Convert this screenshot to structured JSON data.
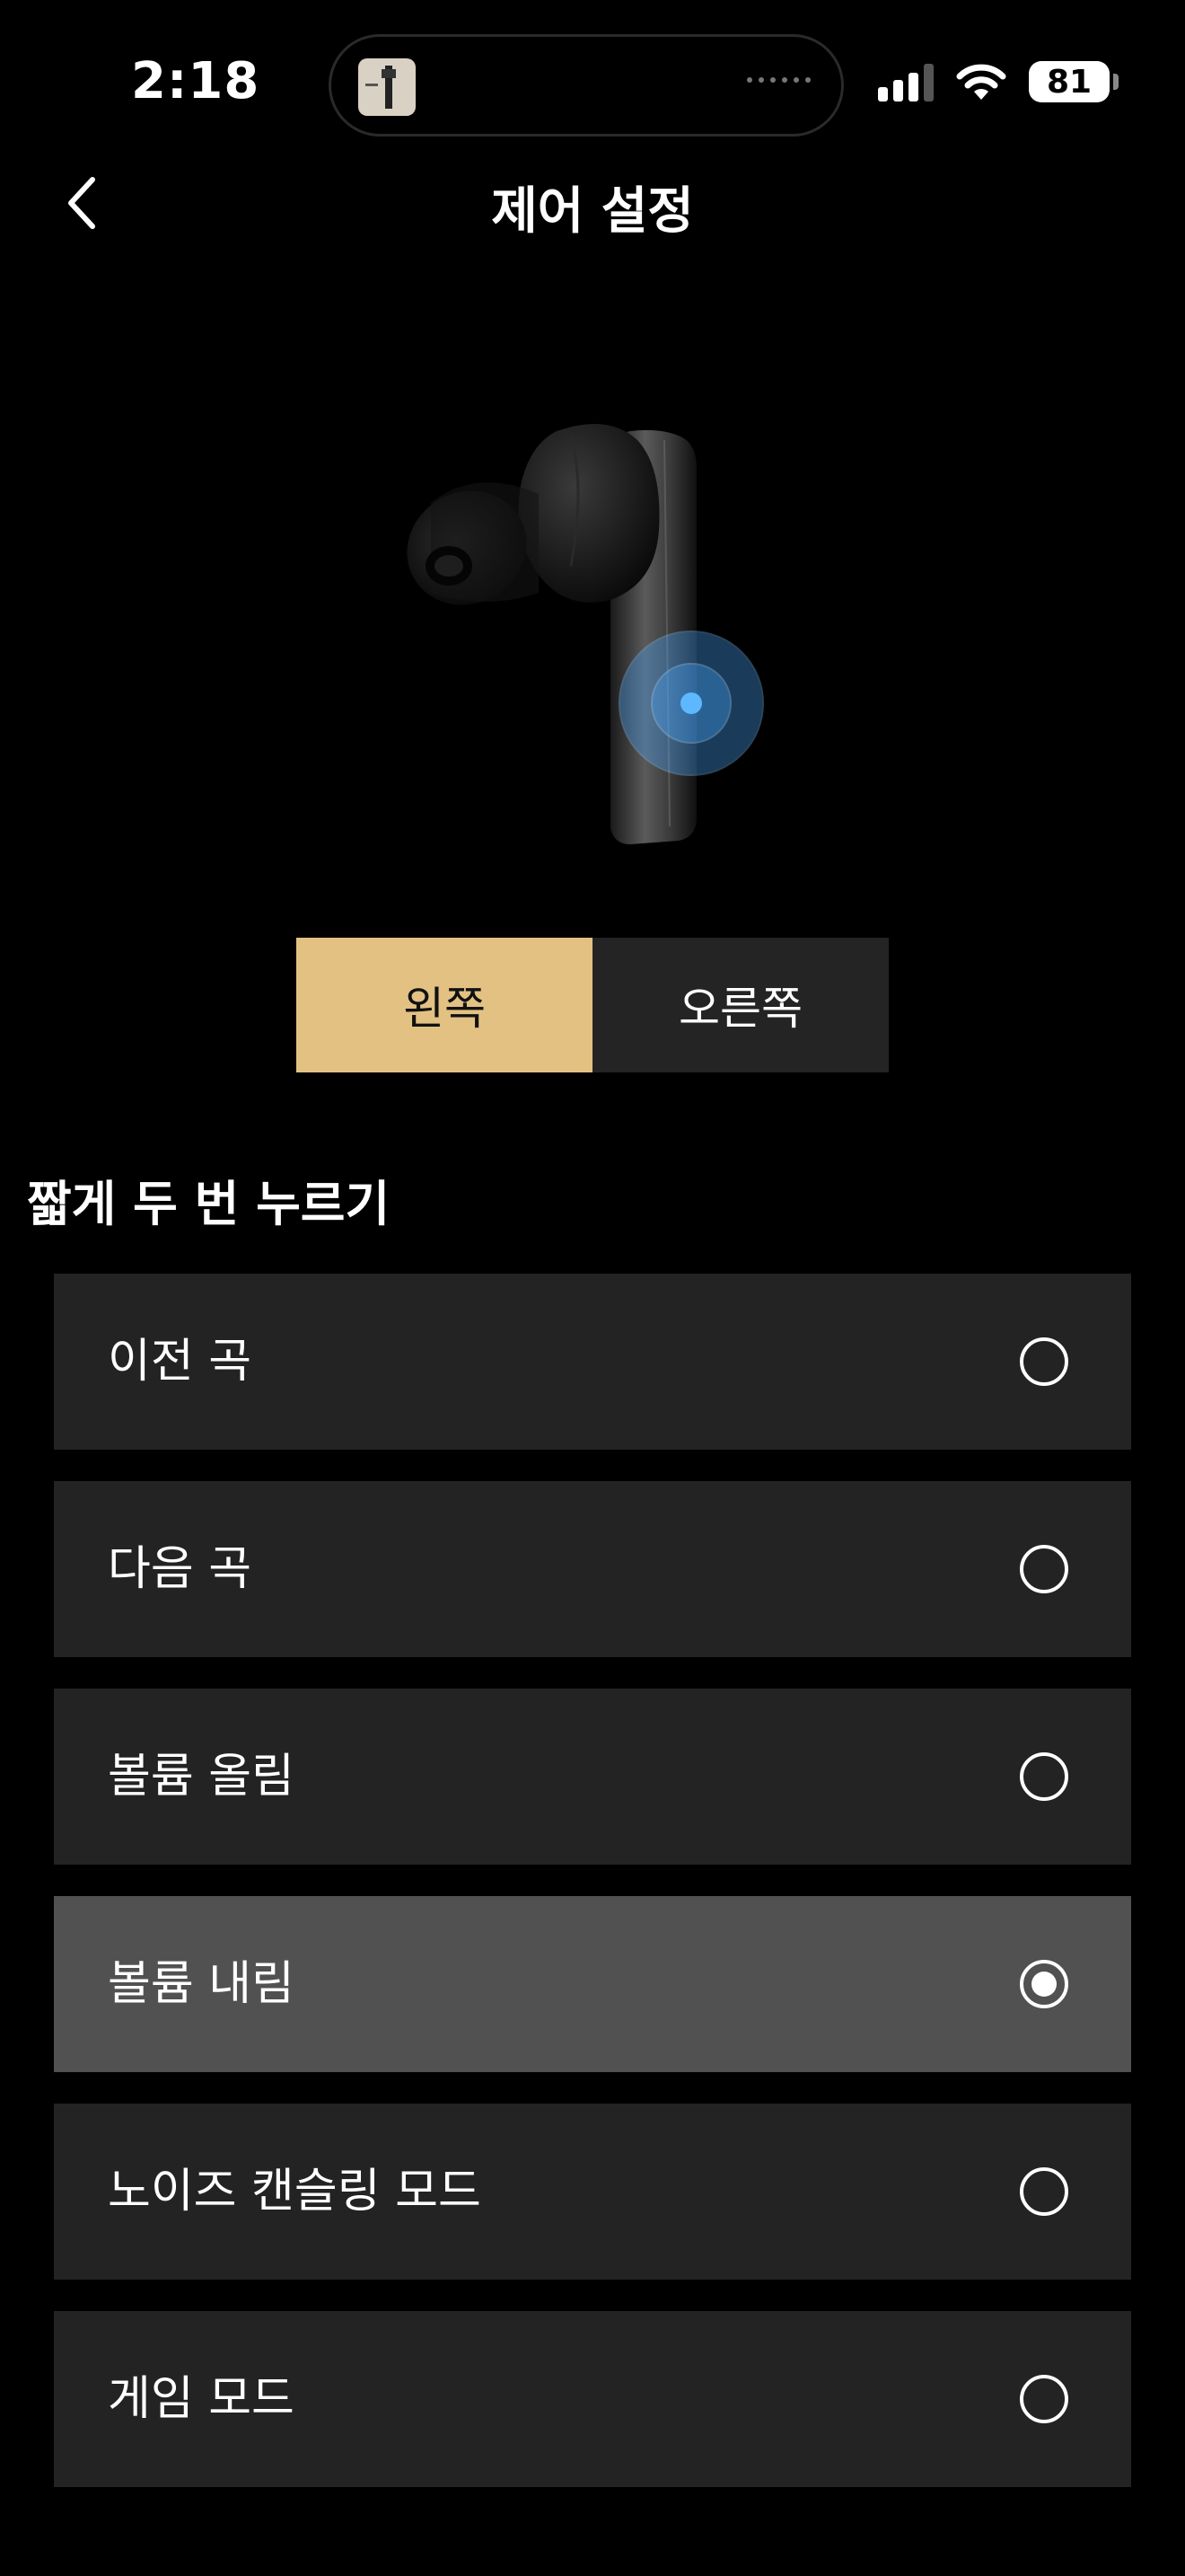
{
  "status_bar": {
    "time": "2:18",
    "battery": "81"
  },
  "header": {
    "title": "제어 설정"
  },
  "side_toggle": {
    "left_label": "왼쪽",
    "right_label": "오른쪽",
    "selected": "left"
  },
  "section": {
    "title": "짧게 두 번 누르기",
    "options": [
      {
        "label": "이전 곡",
        "selected": false
      },
      {
        "label": "다음 곡",
        "selected": false
      },
      {
        "label": "볼륨 올림",
        "selected": false
      },
      {
        "label": "볼륨 내림",
        "selected": true
      },
      {
        "label": "노이즈 캔슬링 모드",
        "selected": false
      },
      {
        "label": "게임 모드",
        "selected": false
      }
    ]
  },
  "colors": {
    "background": "#000000",
    "accent": "#e2c183",
    "option_bg": "#232323",
    "option_selected_bg": "#515151",
    "touch_indicator": "#4aa8ff"
  }
}
